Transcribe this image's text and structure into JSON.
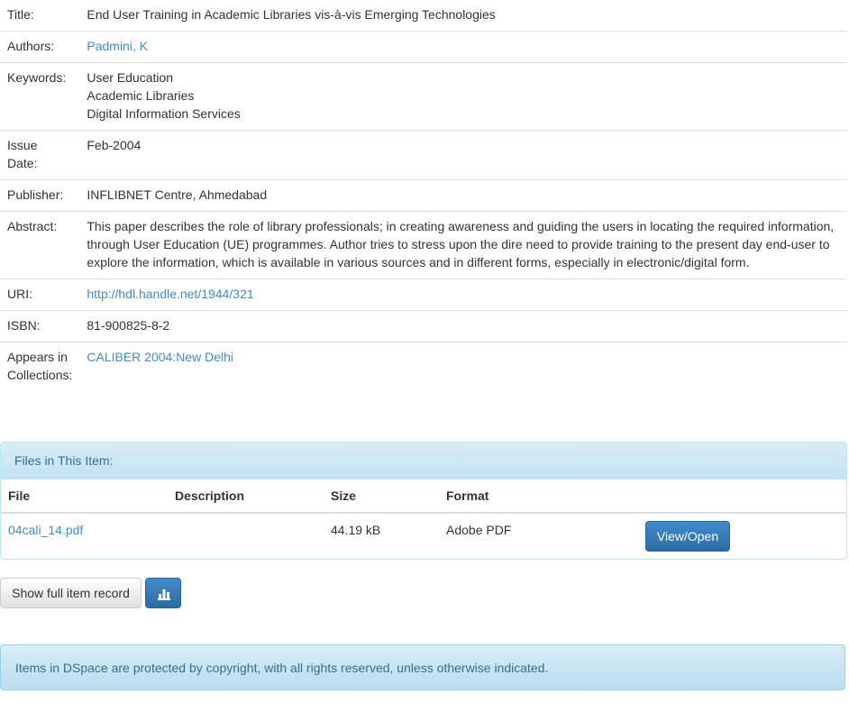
{
  "metadata": {
    "title_label": "Title:",
    "title_value": "End User Training in Academic Libraries vis-à-vis Emerging Technologies",
    "authors_label": "Authors:",
    "authors_value": "Padmini, K",
    "keywords_label": "Keywords:",
    "keywords": [
      "User Education",
      "Academic Libraries",
      "Digital Information Services"
    ],
    "issue_date_label_line1": "Issue",
    "issue_date_label_line2": "Date:",
    "issue_date_value": "Feb-2004",
    "publisher_label": "Publisher:",
    "publisher_value": "INFLIBNET Centre, Ahmedabad",
    "abstract_label": "Abstract:",
    "abstract_value": "This paper describes the role of library professionals; in creating awareness and guiding the users in locating the required information, through User Education (UE) programmes. Author tries to stress upon the dire need to provide training to the present day end-user to explore the information, which is available in various sources and in different forms, especially in electronic/digital form.",
    "uri_label": "URI:",
    "uri_value": "http://hdl.handle.net/1944/321",
    "isbn_label": "ISBN:",
    "isbn_value": "81-900825-8-2",
    "collections_label_line1": "Appears in",
    "collections_label_line2": "Collections:",
    "collections_value": "CALIBER 2004:New Delhi"
  },
  "files": {
    "heading": "Files in This Item:",
    "columns": {
      "file": "File",
      "description": "Description",
      "size": "Size",
      "format": "Format"
    },
    "rows": [
      {
        "file": "04cali_14.pdf",
        "description": "",
        "size": "44.19 kB",
        "format": "Adobe PDF",
        "action": "View/Open"
      }
    ]
  },
  "actions": {
    "full_record_label": "Show full item record",
    "stats_icon": "bar-chart-icon"
  },
  "footer": {
    "copyright": "Items in DSpace are protected by copyright, with all rights reserved, unless otherwise indicated."
  },
  "colors": {
    "link": "#428bca",
    "info_text": "#31708f",
    "primary_button": "#3071a9"
  }
}
